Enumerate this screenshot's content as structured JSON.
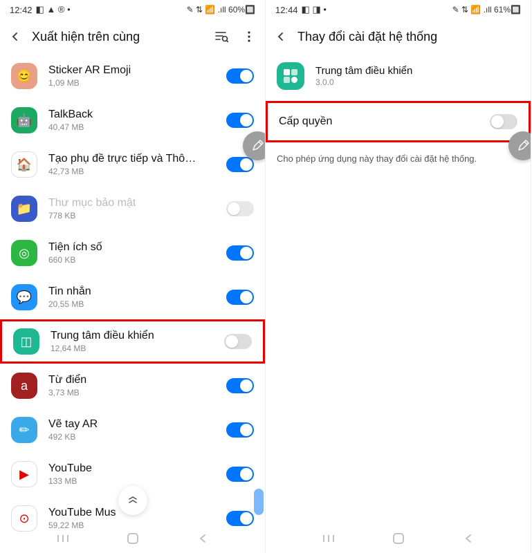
{
  "left": {
    "status": {
      "time": "12:42",
      "icons": "◧ ▲ ® •",
      "right_icons": "✎ ⇅ 📶 .ıll 60%🔲"
    },
    "header": {
      "title": "Xuất hiện trên cùng"
    },
    "apps": [
      {
        "name": "Sticker AR Emoji",
        "size": "1,09 MB",
        "toggle": "on",
        "color": "#e8a088",
        "icon": "😊"
      },
      {
        "name": "TalkBack",
        "size": "40,47 MB",
        "toggle": "on",
        "color": "#1da863",
        "icon": "🤖"
      },
      {
        "name": "Tạo phụ đề trực tiếp và Thông b...",
        "size": "42,73 MB",
        "toggle": "on",
        "color": "#fff",
        "icon": "🏠"
      },
      {
        "name": "Thư mục bảo mật",
        "size": "778 KB",
        "toggle": "disabled",
        "disabled": true,
        "color": "#3b5ac9",
        "icon": "📁"
      },
      {
        "name": "Tiện ích số",
        "size": "660 KB",
        "toggle": "on",
        "color": "#2cb742",
        "icon": "◎"
      },
      {
        "name": "Tin nhắn",
        "size": "20,55 MB",
        "toggle": "on",
        "color": "#2094fa",
        "icon": "💬"
      },
      {
        "name": "Trung tâm điều khiển",
        "size": "12,64 MB",
        "toggle": "off",
        "highlighted": true,
        "color": "#1fb893",
        "icon": "◫"
      },
      {
        "name": "Từ điển",
        "size": "3,73 MB",
        "toggle": "on",
        "color": "#a32020",
        "icon": "a"
      },
      {
        "name": "Vẽ tay AR",
        "size": "492 KB",
        "toggle": "on",
        "color": "#3aa9e8",
        "icon": "✏"
      },
      {
        "name": "YouTube",
        "size": "133 MB",
        "toggle": "on",
        "color": "#fff",
        "icon": "▶"
      },
      {
        "name": "YouTube Mus",
        "size": "59,22 MB",
        "toggle": "on",
        "color": "#fff",
        "icon": "⊙"
      }
    ]
  },
  "right": {
    "status": {
      "time": "12:44",
      "icons": "◧ ◨ •",
      "right_icons": "✎ ⇅ 📶 .ıll 61%🔲"
    },
    "header": {
      "title": "Thay đổi cài đặt hệ thống"
    },
    "app": {
      "name": "Trung tâm điều khiển",
      "version": "3.0.0"
    },
    "permission": {
      "label": "Cấp quyền",
      "toggle": "off"
    },
    "description": "Cho phép ứng dụng này thay đổi cài đặt hệ thống."
  }
}
